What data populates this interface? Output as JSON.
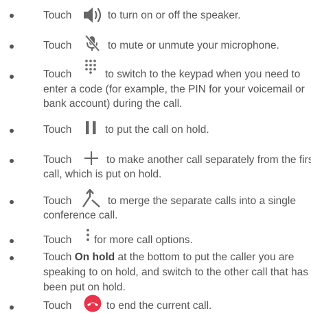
{
  "items": [
    {
      "touch": "Touch",
      "icon": "speaker-icon",
      "lines": [
        "to turn on or off the speaker."
      ]
    },
    {
      "touch": "Touch",
      "icon": "mute-microphone-icon",
      "lines": [
        "to mute or unmute your microphone."
      ]
    },
    {
      "touch": "Touch",
      "icon": "keypad-icon",
      "lines": [
        "to switch to the keypad when you need to",
        "enter a code (for example, the PIN for your voicemail or",
        "bank account) during the call."
      ]
    },
    {
      "touch": "Touch",
      "icon": "pause-icon",
      "lines": [
        "to put the call on hold."
      ]
    },
    {
      "touch": "Touch",
      "icon": "add-call-icon",
      "lines": [
        "to make another call separately from the first",
        "call, which is put on hold."
      ]
    },
    {
      "touch": "Touch",
      "icon": "merge-calls-icon",
      "lines": [
        "to merge the separate calls into a single",
        "conference call."
      ]
    },
    {
      "touch": "Touch",
      "icon": "more-options-icon",
      "lines": [
        "for more call options."
      ]
    },
    {
      "touch": "Touch",
      "bold": "On hold",
      "lines": [
        "at the bottom to put the caller you are",
        "speaking to on hold, and switch to the other call that has",
        "been put on hold."
      ]
    },
    {
      "touch": "Touch",
      "icon": "end-call-icon",
      "lines": [
        "to end the current call."
      ]
    }
  ],
  "colors": {
    "text": "#555555",
    "icon": "#666666",
    "end_call": "#e8334a"
  }
}
